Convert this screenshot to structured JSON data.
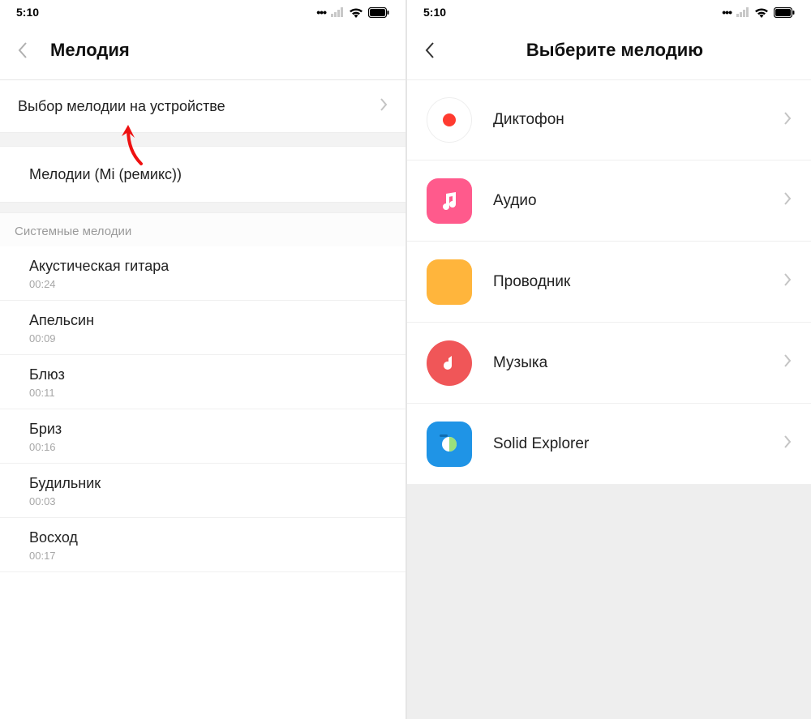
{
  "statusbar": {
    "time": "5:10"
  },
  "left": {
    "header_title": "Мелодия",
    "pick_on_device": "Выбор мелодии на устройстве",
    "remix_label": "Мелодии (Mi (ремикс))",
    "section_system": "Системные мелодии",
    "tones": [
      {
        "name": "Акустическая гитара",
        "dur": "00:24"
      },
      {
        "name": "Апельсин",
        "dur": "00:09"
      },
      {
        "name": "Блюз",
        "dur": "00:11"
      },
      {
        "name": "Бриз",
        "dur": "00:16"
      },
      {
        "name": "Будильник",
        "dur": "00:03"
      },
      {
        "name": "Восход",
        "dur": "00:17"
      }
    ]
  },
  "right": {
    "header_title": "Выберите мелодию",
    "sources": [
      {
        "label": "Диктофон",
        "icon": "recorder"
      },
      {
        "label": "Аудио",
        "icon": "audio"
      },
      {
        "label": "Проводник",
        "icon": "files"
      },
      {
        "label": "Музыка",
        "icon": "music"
      },
      {
        "label": "Solid Explorer",
        "icon": "solid"
      }
    ]
  },
  "colors": {
    "accent_pink": "#ff5a8c",
    "accent_orange": "#ffb53c",
    "accent_red": "#f05658",
    "accent_blue": "#1f94e6"
  }
}
